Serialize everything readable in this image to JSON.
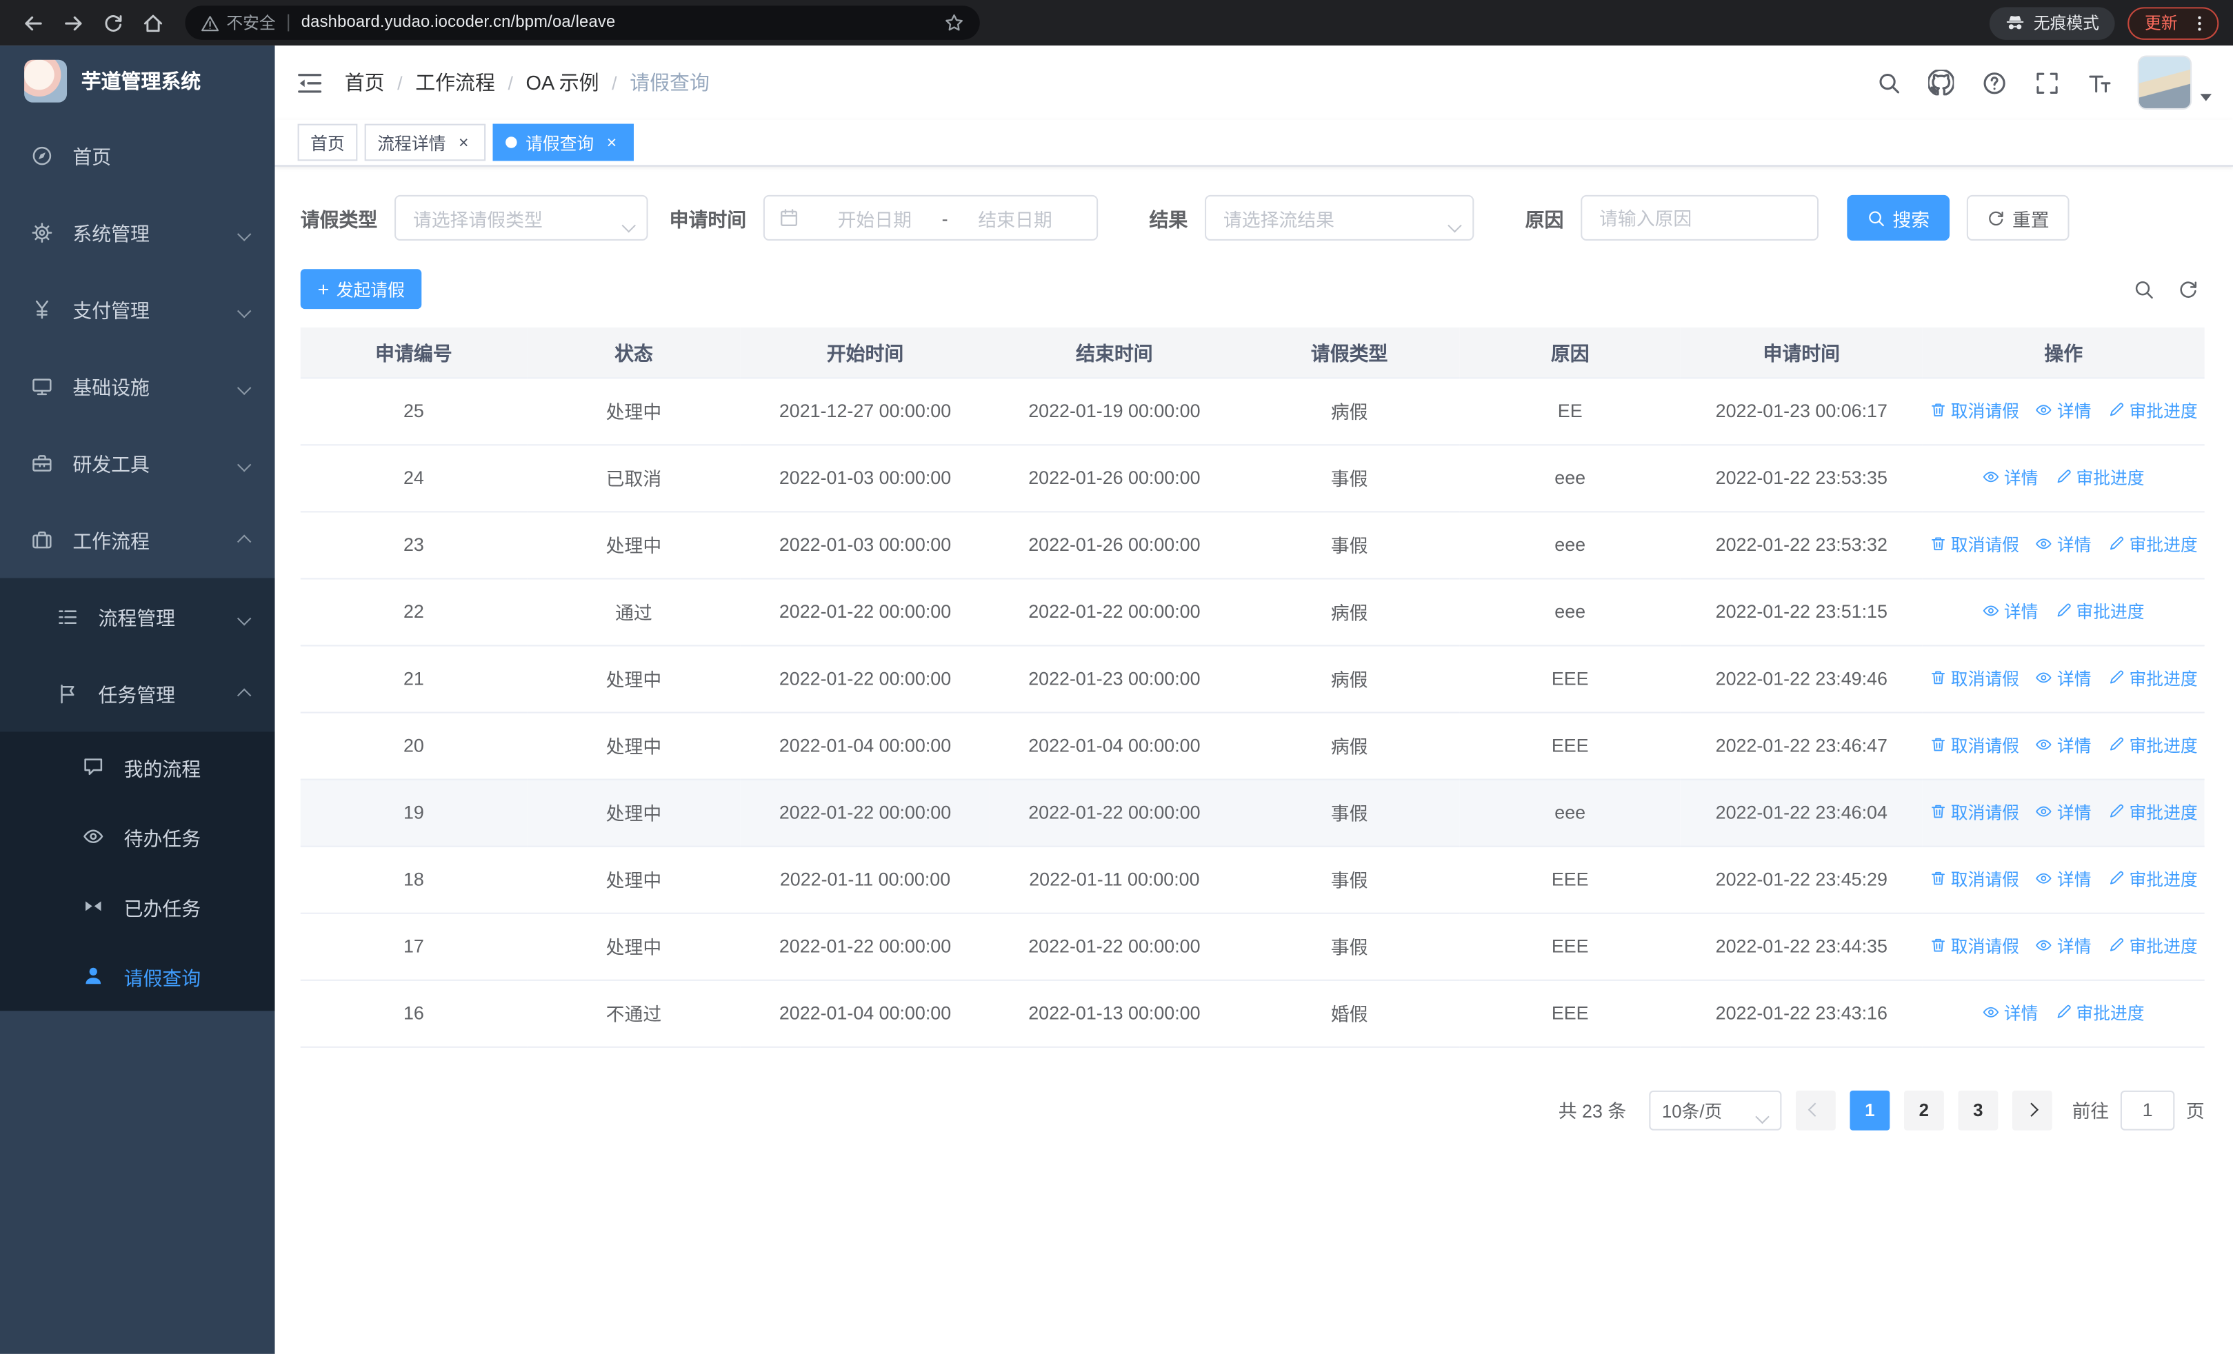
{
  "colors": {
    "accent": "#409eff",
    "sidebar_bg": "#304156",
    "sidebar_submenu_bg": "#1f2d3d",
    "chrome_bg": "#202124"
  },
  "browser": {
    "security_label": "不安全",
    "url": "dashboard.yudao.iocoder.cn/bpm/oa/leave",
    "incognito_label": "无痕模式",
    "update_label": "更新"
  },
  "sidebar": {
    "logo_title": "芋道管理系统",
    "items": [
      {
        "label": "首页",
        "icon": "home-icon"
      },
      {
        "label": "系统管理",
        "icon": "gear-icon"
      },
      {
        "label": "支付管理",
        "icon": "yen-icon"
      },
      {
        "label": "基础设施",
        "icon": "monitor-icon"
      },
      {
        "label": "研发工具",
        "icon": "toolbox-icon"
      },
      {
        "label": "工作流程",
        "icon": "suitcase-icon"
      }
    ],
    "workflow_children": [
      {
        "label": "流程管理",
        "icon": "list-icon"
      },
      {
        "label": "任务管理",
        "icon": "flag-icon"
      }
    ],
    "task_children": [
      {
        "label": "我的流程",
        "icon": "chat-icon"
      },
      {
        "label": "待办任务",
        "icon": "eye-icon"
      },
      {
        "label": "已办任务",
        "icon": "bowtie-icon"
      },
      {
        "label": "请假查询",
        "icon": "user-icon"
      }
    ]
  },
  "header": {
    "breadcrumb": [
      "首页",
      "工作流程",
      "OA 示例",
      "请假查询"
    ]
  },
  "tabs": [
    {
      "label": "首页"
    },
    {
      "label": "流程详情"
    },
    {
      "label": "请假查询"
    }
  ],
  "filters": {
    "leave_type_label": "请假类型",
    "leave_type_placeholder": "请选择请假类型",
    "apply_time_label": "申请时间",
    "start_date_placeholder": "开始日期",
    "date_separator": "-",
    "end_date_placeholder": "结束日期",
    "result_label": "结果",
    "result_placeholder": "请选择流结果",
    "reason_label": "原因",
    "reason_placeholder": "请输入原因",
    "search_button": "搜索",
    "reset_button": "重置"
  },
  "toolbar": {
    "create_button": "发起请假"
  },
  "table": {
    "columns": [
      "申请编号",
      "状态",
      "开始时间",
      "结束时间",
      "请假类型",
      "原因",
      "申请时间",
      "操作"
    ],
    "actions": {
      "cancel": "取消请假",
      "detail": "详情",
      "progress": "审批进度"
    },
    "rows": [
      {
        "id": "25",
        "status": "处理中",
        "start": "2021-12-27 00:00:00",
        "end": "2022-01-19 00:00:00",
        "type": "病假",
        "reason": "EE",
        "apply_time": "2022-01-23 00:06:17",
        "can_cancel": true,
        "highlighted": false
      },
      {
        "id": "24",
        "status": "已取消",
        "start": "2022-01-03 00:00:00",
        "end": "2022-01-26 00:00:00",
        "type": "事假",
        "reason": "eee",
        "apply_time": "2022-01-22 23:53:35",
        "can_cancel": false,
        "highlighted": false
      },
      {
        "id": "23",
        "status": "处理中",
        "start": "2022-01-03 00:00:00",
        "end": "2022-01-26 00:00:00",
        "type": "事假",
        "reason": "eee",
        "apply_time": "2022-01-22 23:53:32",
        "can_cancel": true,
        "highlighted": false
      },
      {
        "id": "22",
        "status": "通过",
        "start": "2022-01-22 00:00:00",
        "end": "2022-01-22 00:00:00",
        "type": "病假",
        "reason": "eee",
        "apply_time": "2022-01-22 23:51:15",
        "can_cancel": false,
        "highlighted": false
      },
      {
        "id": "21",
        "status": "处理中",
        "start": "2022-01-22 00:00:00",
        "end": "2022-01-23 00:00:00",
        "type": "病假",
        "reason": "EEE",
        "apply_time": "2022-01-22 23:49:46",
        "can_cancel": true,
        "highlighted": false
      },
      {
        "id": "20",
        "status": "处理中",
        "start": "2022-01-04 00:00:00",
        "end": "2022-01-04 00:00:00",
        "type": "病假",
        "reason": "EEE",
        "apply_time": "2022-01-22 23:46:47",
        "can_cancel": true,
        "highlighted": false
      },
      {
        "id": "19",
        "status": "处理中",
        "start": "2022-01-22 00:00:00",
        "end": "2022-01-22 00:00:00",
        "type": "事假",
        "reason": "eee",
        "apply_time": "2022-01-22 23:46:04",
        "can_cancel": true,
        "highlighted": true
      },
      {
        "id": "18",
        "status": "处理中",
        "start": "2022-01-11 00:00:00",
        "end": "2022-01-11 00:00:00",
        "type": "事假",
        "reason": "EEE",
        "apply_time": "2022-01-22 23:45:29",
        "can_cancel": true,
        "highlighted": false
      },
      {
        "id": "17",
        "status": "处理中",
        "start": "2022-01-22 00:00:00",
        "end": "2022-01-22 00:00:00",
        "type": "事假",
        "reason": "EEE",
        "apply_time": "2022-01-22 23:44:35",
        "can_cancel": true,
        "highlighted": false
      },
      {
        "id": "16",
        "status": "不通过",
        "start": "2022-01-04 00:00:00",
        "end": "2022-01-13 00:00:00",
        "type": "婚假",
        "reason": "EEE",
        "apply_time": "2022-01-22 23:43:16",
        "can_cancel": false,
        "highlighted": false
      }
    ]
  },
  "pagination": {
    "total_label": "共 23 条",
    "page_size_label": "10条/页",
    "pages": [
      "1",
      "2",
      "3"
    ],
    "active_page": "1",
    "goto_label": "前往",
    "goto_value": "1",
    "goto_unit": "页"
  }
}
